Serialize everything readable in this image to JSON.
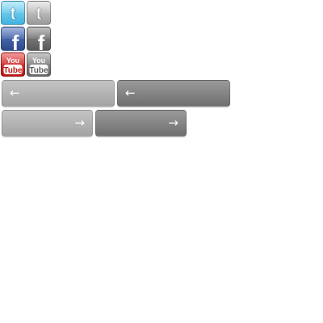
{
  "social_buttons": [
    {
      "network": "twitter",
      "state": "color",
      "glyph": "t",
      "icon": "twitter-icon",
      "color": "#3fb3e0"
    },
    {
      "network": "twitter",
      "state": "gray",
      "glyph": "t",
      "icon": "twitter-icon",
      "color": "#9a9a9a"
    },
    {
      "network": "facebook",
      "state": "color",
      "glyph": "f",
      "icon": "facebook-icon",
      "color": "#2d4a8c"
    },
    {
      "network": "facebook",
      "state": "gray",
      "glyph": "f",
      "icon": "facebook-icon",
      "color": "#5a5a5a"
    },
    {
      "network": "youtube",
      "state": "color",
      "top_text": "You",
      "bottom_text": "Tube",
      "icon": "youtube-icon",
      "color": "#b81414"
    },
    {
      "network": "youtube",
      "state": "gray",
      "top_text": "You",
      "bottom_text": "Tube",
      "icon": "youtube-icon",
      "color": "#666666"
    }
  ],
  "nav_buttons": {
    "prev_light": {
      "arrow": "←",
      "icon": "arrow-left-icon",
      "color": "#a3a3a3"
    },
    "prev_dark": {
      "arrow": "←",
      "icon": "arrow-left-icon",
      "color": "#6f6f6f"
    },
    "next_light": {
      "arrow": "→",
      "icon": "arrow-right-icon",
      "color": "#a3a3a3"
    },
    "next_dark": {
      "arrow": "→",
      "icon": "arrow-right-icon",
      "color": "#6f6f6f"
    }
  }
}
